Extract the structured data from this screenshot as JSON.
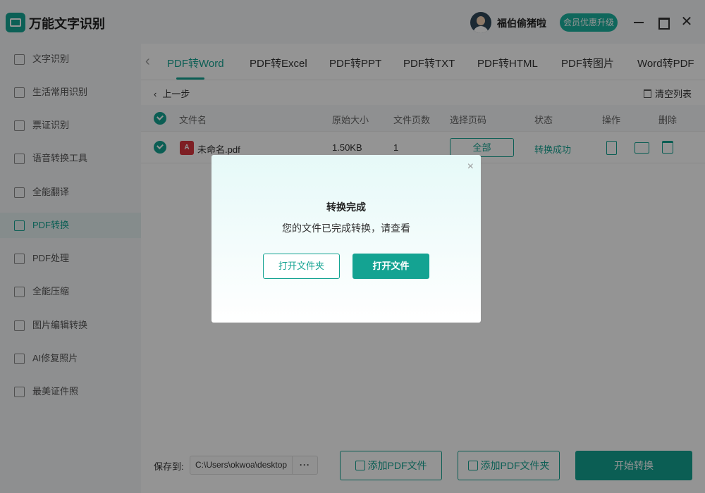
{
  "app": {
    "title": "万能文字识别"
  },
  "user": {
    "name": "福伯偷猪啦",
    "vip_label": "会员优惠升级"
  },
  "window": {
    "close_glyph": "✕"
  },
  "sidebar": {
    "items": [
      {
        "label": "文字识别"
      },
      {
        "label": "生活常用识别"
      },
      {
        "label": "票证识别"
      },
      {
        "label": "语音转换工具"
      },
      {
        "label": "全能翻译"
      },
      {
        "label": "PDF转换"
      },
      {
        "label": "PDF处理"
      },
      {
        "label": "全能压缩"
      },
      {
        "label": "图片编辑转换"
      },
      {
        "label": "AI修复照片"
      },
      {
        "label": "最美证件照"
      }
    ],
    "active_index": 5
  },
  "tabs": {
    "prev_glyph": "‹",
    "items": [
      {
        "label": "PDF转Word"
      },
      {
        "label": "PDF转Excel"
      },
      {
        "label": "PDF转PPT"
      },
      {
        "label": "PDF转TXT"
      },
      {
        "label": "PDF转HTML"
      },
      {
        "label": "PDF转图片"
      },
      {
        "label": "Word转PDF"
      }
    ]
  },
  "toolbar": {
    "back_glyph": "‹",
    "back_label": "上一步",
    "clear_label": "清空列表"
  },
  "table": {
    "headers": {
      "name": "文件名",
      "size": "原始大小",
      "pages": "文件页数",
      "page_select": "选择页码",
      "status": "状态",
      "actions": "操作",
      "delete": "删除"
    },
    "rows": [
      {
        "name": "未命名.pdf",
        "size": "1.50KB",
        "pages": "1",
        "page_select": "全部",
        "status": "转换成功",
        "file_icon_text": "A"
      }
    ]
  },
  "bottom": {
    "save_label": "保存到:",
    "save_path": "C:\\Users\\okwoa\\desktop",
    "more_glyph": "···",
    "add_file_label": "添加PDF文件",
    "add_folder_label": "添加PDF文件夹",
    "start_label": "开始转换"
  },
  "modal": {
    "close_glyph": "×",
    "title": "转换完成",
    "message": "您的文件已完成转换，请查看",
    "open_folder_label": "打开文件夹",
    "open_file_label": "打开文件"
  },
  "colors": {
    "accent": "#14a392",
    "overlay": "rgba(0,0,0,0.42)"
  }
}
